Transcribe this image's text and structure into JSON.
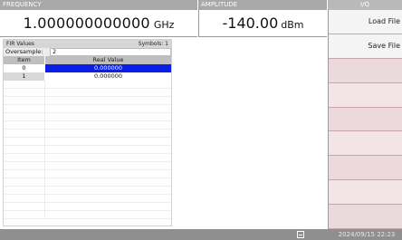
{
  "header": {
    "frequency_label": "FREQUENCY",
    "frequency_value": "1.000000000000",
    "frequency_unit": "GHz",
    "amplitude_label": "AMPLITUDE",
    "amplitude_value": "-140.00",
    "amplitude_unit": "dBm",
    "io_label": "I/Q"
  },
  "softkeys": [
    "Load File",
    "Save File",
    "",
    "",
    "",
    "",
    "",
    "",
    ""
  ],
  "fir": {
    "title": "FIR Values",
    "symbols": "Symbols: 1",
    "oversample_label": "Oversample:",
    "oversample_value": "2",
    "col_item": "Item",
    "col_real": "Real Value",
    "rows": [
      {
        "item": "0",
        "value": "0.000000"
      },
      {
        "item": "1",
        "value": "0.000000"
      }
    ]
  },
  "status": {
    "datetime": "2024/09/15 22:23",
    "icon": "network-icon"
  },
  "colors": {
    "selection": "#0a1ee6",
    "header_bar": "#a8a8a8",
    "softkey_blank": "#ecd9db"
  }
}
